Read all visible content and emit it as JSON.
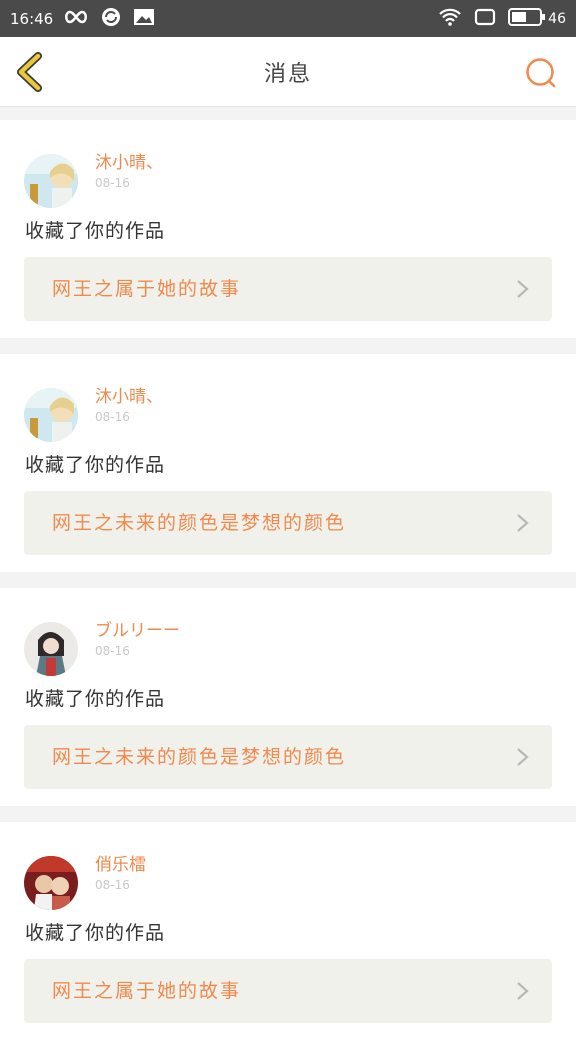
{
  "status_bar": {
    "time": "16:46",
    "battery": "46",
    "left_icons": [
      "infinity-icon",
      "sync-icon",
      "image-icon"
    ],
    "right_icons": [
      "wifi-icon",
      "screen-icon",
      "battery-icon"
    ]
  },
  "header": {
    "title": "消息",
    "back_icon": "chevron-left-icon",
    "search_icon": "search-icon",
    "accent_back": "#e8c93a",
    "accent_search": "#ef8a4e"
  },
  "messages": [
    {
      "username": "沐小晴、",
      "time": "08-16",
      "action": "收藏了你的作品",
      "work_title": "网王之属于她的故事"
    },
    {
      "username": "沐小晴、",
      "time": "08-16",
      "action": "收藏了你的作品",
      "work_title": "网王之未来的颜色是梦想的颜色"
    },
    {
      "username": "ブルリーー",
      "time": "08-16",
      "action": "收藏了你的作品",
      "work_title": "网王之未来的颜色是梦想的颜色"
    },
    {
      "username": "俏乐檑",
      "time": "08-16",
      "action": "收藏了你的作品",
      "work_title": "网王之属于她的故事"
    }
  ],
  "colors": {
    "accent": "#ef8a4e",
    "link_bg": "#f1f1eb"
  }
}
